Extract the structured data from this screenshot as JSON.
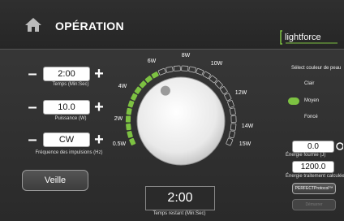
{
  "header": {
    "title": "OPÉRATION",
    "logo_text": "lightforce"
  },
  "params": {
    "time": {
      "value": "2:00",
      "caption": "Temps (Min:Sec)"
    },
    "power": {
      "value": "10.0",
      "caption": "Puissance (W)"
    },
    "pulse": {
      "value": "CW",
      "caption": "Fréquence des impulsions (Hz)"
    },
    "minus": "–",
    "plus": "+"
  },
  "dial": {
    "labels": [
      "0.5W",
      "2W",
      "4W",
      "6W",
      "8W",
      "10W",
      "12W",
      "14W",
      "15W"
    ],
    "level_fraction": 0.38
  },
  "standby_button": "Veille",
  "remaining": {
    "value": "2:00",
    "caption": "Temps restant (Min:Sec)"
  },
  "skin": {
    "title": "Sélect couleur de peau",
    "options": [
      "Clair",
      "Moyen",
      "Foncé"
    ],
    "selected": "Moyen"
  },
  "energy": {
    "value": "0.0",
    "caption": "Énergie fournie (J)",
    "total_value": "1200.0",
    "total_caption": "Énergie traitement calculée (J)"
  },
  "buttons": {
    "protocol": "PERFECTProtocol™",
    "disabled": "Démarrer"
  },
  "colors": {
    "accent_green": "#7dc242",
    "inactive_tick": "#bdbdbd"
  }
}
